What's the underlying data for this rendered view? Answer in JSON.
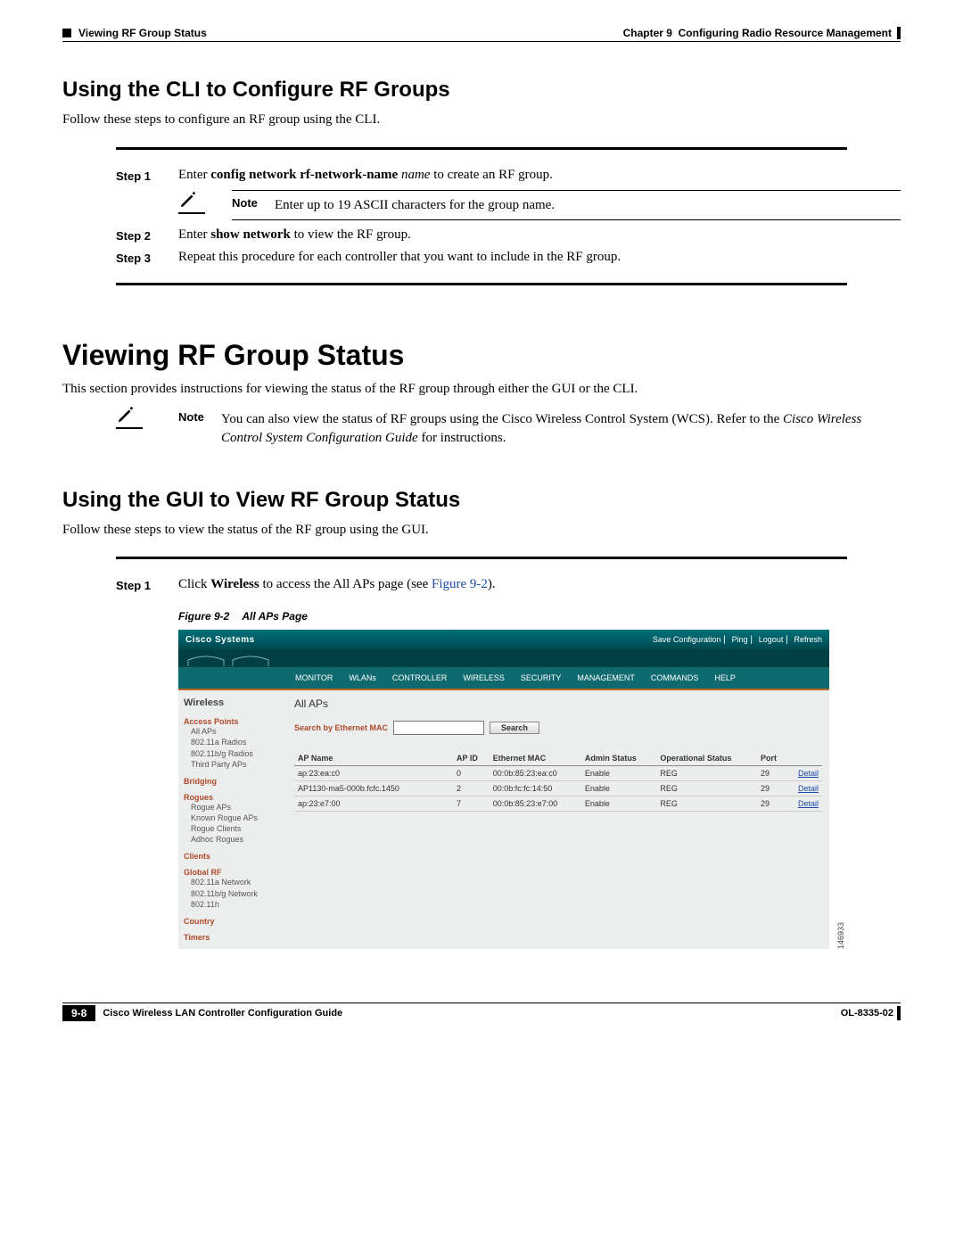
{
  "header": {
    "left": "Viewing RF Group Status",
    "right_prefix": "Chapter 9",
    "right_title": "Configuring Radio Resource Management"
  },
  "sections": {
    "h2a": "Using the CLI to Configure RF Groups",
    "h2a_intro": "Follow these steps to configure an RF group using the CLI.",
    "step1": {
      "label": "Step 1",
      "pre": "Enter ",
      "cmd": "config network rf-network-name",
      "arg": " name",
      "post": " to create an RF group."
    },
    "note1": {
      "label": "Note",
      "text": "Enter up to 19 ASCII characters for the group name."
    },
    "step2": {
      "label": "Step 2",
      "pre": "Enter ",
      "cmd": "show network",
      "post": " to view the RF group."
    },
    "step3": {
      "label": "Step 3",
      "text": "Repeat this procedure for each controller that you want to include in the RF group."
    },
    "h1": "Viewing RF Group Status",
    "h1_intro": "This section provides instructions for viewing the status of the RF group through either the GUI or the CLI.",
    "note2": {
      "label": "Note",
      "text_a": "You can also view the status of RF groups using the Cisco Wireless Control System (WCS). Refer to the ",
      "text_i": "Cisco Wireless Control System Configuration Guide",
      "text_b": " for instructions."
    },
    "h2b": "Using the GUI to View RF Group Status",
    "h2b_intro": "Follow these steps to view the status of the RF group using the GUI.",
    "step1b": {
      "label": "Step 1",
      "pre": "Click ",
      "cmd": "Wireless",
      "mid": " to access the All APs page (see ",
      "link": "Figure 9-2",
      "post": ")."
    },
    "fig": {
      "num": "Figure 9-2",
      "title": "All APs Page",
      "id": "146933"
    }
  },
  "gui": {
    "brand": "Cisco Systems",
    "top_links": [
      "Save Configuration",
      "Ping",
      "Logout",
      "Refresh"
    ],
    "tabs": [
      "MONITOR",
      "WLANs",
      "CONTROLLER",
      "WIRELESS",
      "SECURITY",
      "MANAGEMENT",
      "COMMANDS",
      "HELP"
    ],
    "side_title": "Wireless",
    "side": {
      "g1": "Access Points",
      "g1s": [
        "All APs",
        "802.11a Radios",
        "802.11b/g Radios",
        "Third Party APs"
      ],
      "g2": "Bridging",
      "g3": "Rogues",
      "g3s": [
        "Rogue APs",
        "Known Rogue APs",
        "Rogue Clients",
        "Adhoc Rogues"
      ],
      "g4": "Clients",
      "g5": "Global RF",
      "g5s": [
        "802.11a Network",
        "802.11b/g Network",
        "802.11h"
      ],
      "g6": "Country",
      "g7": "Timers"
    },
    "main_title": "All APs",
    "search": {
      "label": "Search by Ethernet MAC",
      "button": "Search"
    },
    "table": {
      "headers": [
        "AP Name",
        "AP ID",
        "Ethernet MAC",
        "Admin Status",
        "Operational Status",
        "Port",
        ""
      ],
      "rows": [
        [
          "ap:23:ea:c0",
          "0",
          "00:0b:85:23:ea:c0",
          "Enable",
          "REG",
          "29",
          "Detail"
        ],
        [
          "AP1130-ma5-000b.fcfc.1450",
          "2",
          "00:0b:fc:fc:14:50",
          "Enable",
          "REG",
          "29",
          "Detail"
        ],
        [
          "ap:23:e7:00",
          "7",
          "00:0b:85:23:e7:00",
          "Enable",
          "REG",
          "29",
          "Detail"
        ]
      ]
    }
  },
  "footer": {
    "title": "Cisco Wireless LAN Controller Configuration Guide",
    "page": "9-8",
    "doc": "OL-8335-02"
  }
}
